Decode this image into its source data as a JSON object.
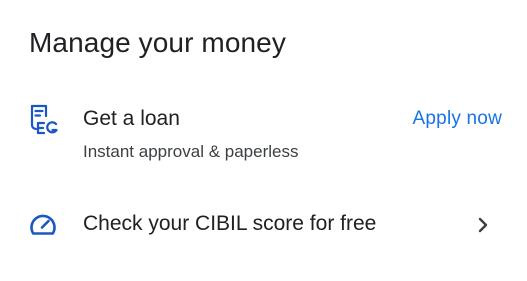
{
  "section": {
    "title": "Manage your money"
  },
  "loan": {
    "icon": "loan-document-icon",
    "title": "Get a loan",
    "subtitle": "Instant approval & paperless",
    "action_label": "Apply now"
  },
  "cibil": {
    "icon": "speedometer-icon",
    "title": "Check your CIBIL score for free",
    "trailing_icon": "chevron-right-icon"
  },
  "colors": {
    "accent": "#1a73e8",
    "icon": "#1a56c4",
    "text_primary": "#202124",
    "text_secondary": "#3c4043"
  }
}
